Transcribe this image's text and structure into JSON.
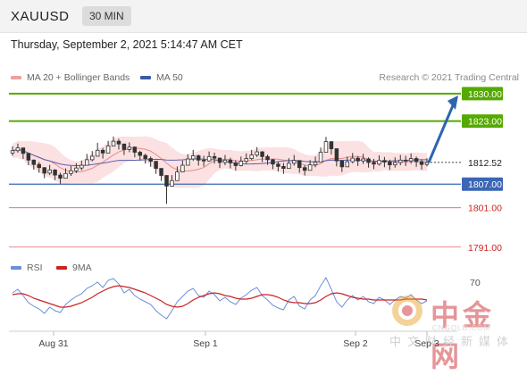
{
  "header": {
    "symbol": "XAUUSD",
    "timeframe": "30 MIN"
  },
  "datetime": "Thursday, September 2, 2021 5:14:47 AM CET",
  "legend": {
    "ma20_label": "MA 20 + Bollinger Bands",
    "ma50_label": "MA 50",
    "credit": "Research © 2021 Trading Central"
  },
  "rsi_legend": {
    "rsi_label": "RSI",
    "ma_label": "9MA"
  },
  "colors": {
    "resistance": "#55aa00",
    "support": "#3a66b5",
    "support_weak": "#e06060",
    "current": "#444444",
    "up_candle": "#333333",
    "down_candle": "#333333",
    "bollinger": "#f7c9c9",
    "ma20": "#e88a8a",
    "ma50": "#5560b0",
    "rsi": "#6a8fd8",
    "rsi_ma": "#cc2222",
    "arrow": "#2c64b0"
  },
  "chart_data": [
    {
      "type": "candlestick",
      "title": "XAUUSD 30 MIN",
      "x_ticks": [
        "Aug 31",
        "Sep 1",
        "Sep 2",
        "Sep 3"
      ],
      "ylim": [
        1788,
        1832
      ],
      "levels": [
        {
          "value": 1830.0,
          "label": "1830.00",
          "kind": "resistance"
        },
        {
          "value": 1823.0,
          "label": "1823.00",
          "kind": "resistance"
        },
        {
          "value": 1812.52,
          "label": "1812.52",
          "kind": "current"
        },
        {
          "value": 1807.0,
          "label": "1807.00",
          "kind": "support"
        },
        {
          "value": 1801.0,
          "label": "1801.00",
          "kind": "support_weak"
        },
        {
          "value": 1791.0,
          "label": "1791.00",
          "kind": "support_weak"
        }
      ],
      "forecast_target": 1830.0,
      "close_series": [
        1815.5,
        1816.2,
        1814.8,
        1813.1,
        1812.0,
        1811.2,
        1809.8,
        1810.6,
        1809.3,
        1808.5,
        1809.7,
        1810.4,
        1811.1,
        1811.8,
        1813.2,
        1814.1,
        1815.6,
        1814.9,
        1816.7,
        1817.9,
        1817.2,
        1815.8,
        1816.4,
        1815.1,
        1814.3,
        1813.5,
        1812.8,
        1811.0,
        1809.2,
        1806.5,
        1807.9,
        1810.1,
        1811.8,
        1813.4,
        1814.2,
        1813.1,
        1812.9,
        1814.0,
        1813.6,
        1812.5,
        1813.1,
        1812.4,
        1811.7,
        1812.8,
        1813.5,
        1814.4,
        1815.2,
        1814.0,
        1813.2,
        1812.1,
        1811.5,
        1811.0,
        1812.3,
        1813.0,
        1811.2,
        1810.5,
        1811.9,
        1812.6,
        1815.1,
        1817.8,
        1816.0,
        1812.9,
        1811.4,
        1812.7,
        1813.6,
        1812.9,
        1813.4,
        1812.5,
        1812.1,
        1813.0,
        1812.6,
        1811.9,
        1812.5,
        1813.1,
        1812.9,
        1813.5,
        1812.7,
        1812.0,
        1812.52
      ],
      "high_series": [
        1816.6,
        1817.3,
        1816.1,
        1814.6,
        1813.3,
        1812.6,
        1811.3,
        1811.9,
        1810.8,
        1809.9,
        1811.0,
        1811.6,
        1812.3,
        1813.0,
        1814.7,
        1815.4,
        1817.5,
        1816.2,
        1818.0,
        1819.1,
        1818.5,
        1817.2,
        1817.6,
        1816.6,
        1815.5,
        1814.7,
        1814.0,
        1812.5,
        1810.7,
        1808.3,
        1809.3,
        1811.5,
        1813.0,
        1814.6,
        1815.7,
        1814.5,
        1814.2,
        1815.3,
        1815.0,
        1813.8,
        1814.4,
        1813.7,
        1813.1,
        1814.0,
        1814.8,
        1815.7,
        1816.4,
        1815.4,
        1814.5,
        1813.4,
        1812.8,
        1812.4,
        1813.6,
        1814.4,
        1812.8,
        1811.8,
        1813.1,
        1814.0,
        1816.3,
        1819.0,
        1817.6,
        1814.5,
        1812.8,
        1814.0,
        1814.9,
        1814.1,
        1814.7,
        1813.8,
        1813.4,
        1814.3,
        1813.9,
        1813.2,
        1813.8,
        1814.4,
        1814.2,
        1814.8,
        1814.0,
        1813.3,
        1813.6
      ],
      "low_series": [
        1814.2,
        1815.0,
        1813.4,
        1811.8,
        1810.7,
        1809.9,
        1808.5,
        1809.3,
        1808.0,
        1807.1,
        1808.4,
        1809.1,
        1809.8,
        1810.5,
        1811.9,
        1812.8,
        1814.3,
        1813.5,
        1815.3,
        1816.6,
        1815.8,
        1814.4,
        1815.1,
        1813.8,
        1813.0,
        1812.2,
        1811.4,
        1809.6,
        1807.8,
        1802.0,
        1806.4,
        1808.6,
        1810.4,
        1812.0,
        1812.9,
        1811.7,
        1811.5,
        1812.7,
        1812.2,
        1811.1,
        1811.8,
        1811.0,
        1810.4,
        1811.5,
        1812.2,
        1813.1,
        1813.9,
        1812.6,
        1811.9,
        1810.8,
        1810.2,
        1809.6,
        1811.0,
        1811.7,
        1809.9,
        1809.2,
        1810.6,
        1811.3,
        1813.8,
        1816.3,
        1814.5,
        1811.5,
        1810.1,
        1811.4,
        1812.3,
        1811.6,
        1812.1,
        1811.2,
        1810.8,
        1811.7,
        1811.3,
        1810.6,
        1811.2,
        1811.8,
        1811.6,
        1812.2,
        1811.4,
        1810.7,
        1811.5
      ]
    },
    {
      "type": "line",
      "title": "RSI",
      "ylim": [
        20,
        80
      ],
      "y_ticks": [
        70
      ],
      "series": [
        {
          "name": "RSI",
          "values": [
            58,
            62,
            55,
            47,
            43,
            40,
            35,
            42,
            38,
            36,
            45,
            50,
            54,
            57,
            63,
            66,
            70,
            64,
            72,
            74,
            68,
            58,
            62,
            55,
            51,
            48,
            45,
            38,
            33,
            29,
            38,
            48,
            54,
            60,
            63,
            55,
            53,
            60,
            56,
            49,
            53,
            48,
            45,
            52,
            56,
            61,
            64,
            55,
            50,
            44,
            41,
            39,
            50,
            54,
            43,
            40,
            50,
            55,
            66,
            75,
            62,
            48,
            42,
            50,
            55,
            50,
            54,
            48,
            46,
            53,
            50,
            45,
            50,
            54,
            52,
            56,
            50,
            46,
            49
          ]
        },
        {
          "name": "9MA",
          "values": [
            56,
            57,
            57,
            55,
            52,
            50,
            48,
            46,
            44,
            42,
            42,
            43,
            45,
            47,
            50,
            53,
            57,
            60,
            63,
            65,
            66,
            65,
            64,
            62,
            60,
            58,
            55,
            52,
            49,
            45,
            43,
            42,
            43,
            46,
            50,
            53,
            55,
            57,
            58,
            57,
            55,
            54,
            52,
            51,
            51,
            52,
            54,
            56,
            56,
            55,
            53,
            50,
            48,
            47,
            47,
            46,
            46,
            47,
            50,
            54,
            57,
            58,
            57,
            55,
            53,
            52,
            51,
            51,
            50,
            50,
            50,
            50,
            50,
            50,
            51,
            51,
            51,
            51,
            50
          ]
        }
      ]
    }
  ]
}
